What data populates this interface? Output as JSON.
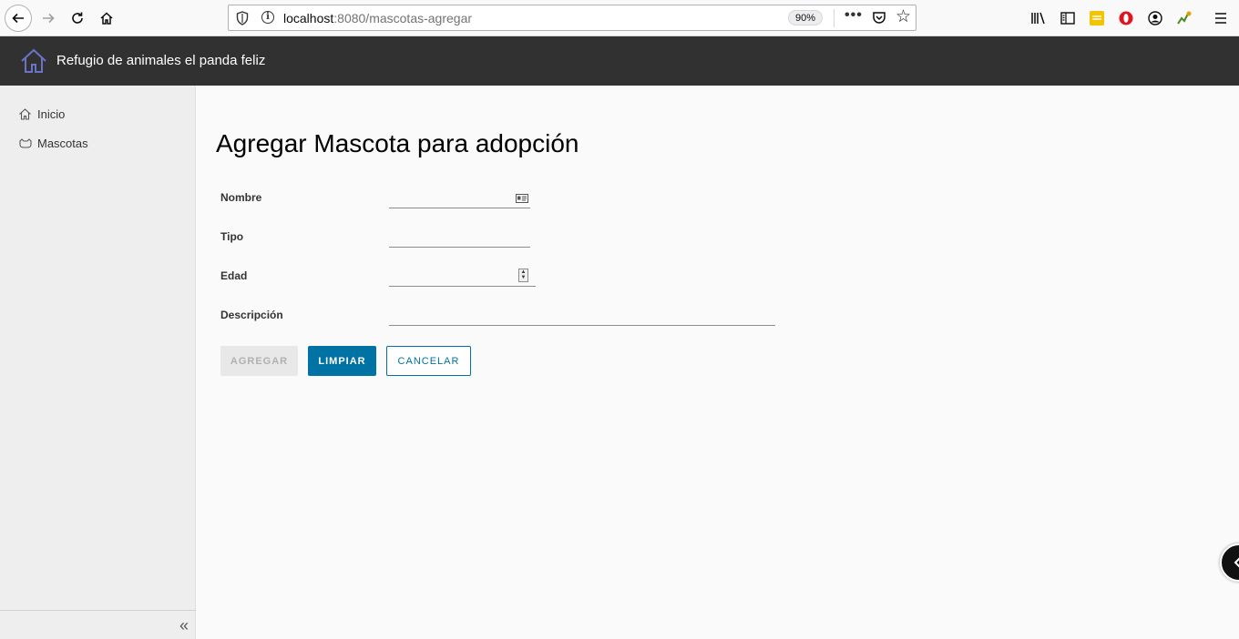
{
  "browser": {
    "url_host": "localhost",
    "url_rest": ":8080/mascotas-agregar",
    "zoom": "90%",
    "more_label": "•••"
  },
  "header": {
    "title": "Refugio de animales el panda feliz"
  },
  "sidebar": {
    "items": [
      {
        "label": "Inicio",
        "icon": "home-icon"
      },
      {
        "label": "Mascotas",
        "icon": "pet-icon"
      }
    ],
    "collapse_glyph": "«"
  },
  "main": {
    "title": "Agregar Mascota para adopción",
    "fields": {
      "nombre": {
        "label": "Nombre",
        "value": ""
      },
      "tipo": {
        "label": "Tipo",
        "value": ""
      },
      "edad": {
        "label": "Edad",
        "value": ""
      },
      "descripcion": {
        "label": "Descripción",
        "value": ""
      }
    },
    "buttons": {
      "agregar": "AGREGAR",
      "limpiar": "LIMPIAR",
      "cancelar": "CANCELAR"
    }
  },
  "colors": {
    "header_bg": "#313131",
    "primary": "#0072a3",
    "sidebar_bg": "#eeeeee",
    "disabled_bg": "#e8e8e8"
  }
}
